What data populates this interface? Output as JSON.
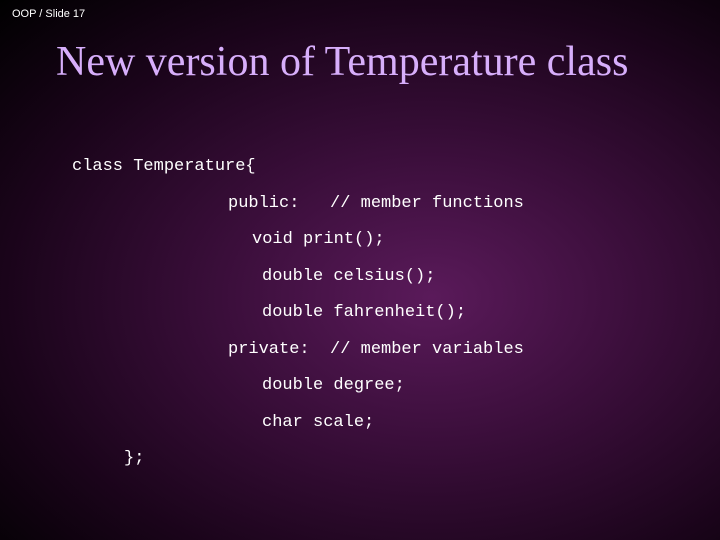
{
  "header": "OOP / Slide 17",
  "title": "New version of  Temperature class",
  "code": {
    "line1": "class Temperature{",
    "line2": "public:   // member functions",
    "line3": "void print();",
    "line4": "double celsius();",
    "line5": "double fahrenheit();",
    "line6": "private:  // member variables",
    "line7": "double degree;",
    "line8": "char scale;",
    "line9": "};"
  }
}
